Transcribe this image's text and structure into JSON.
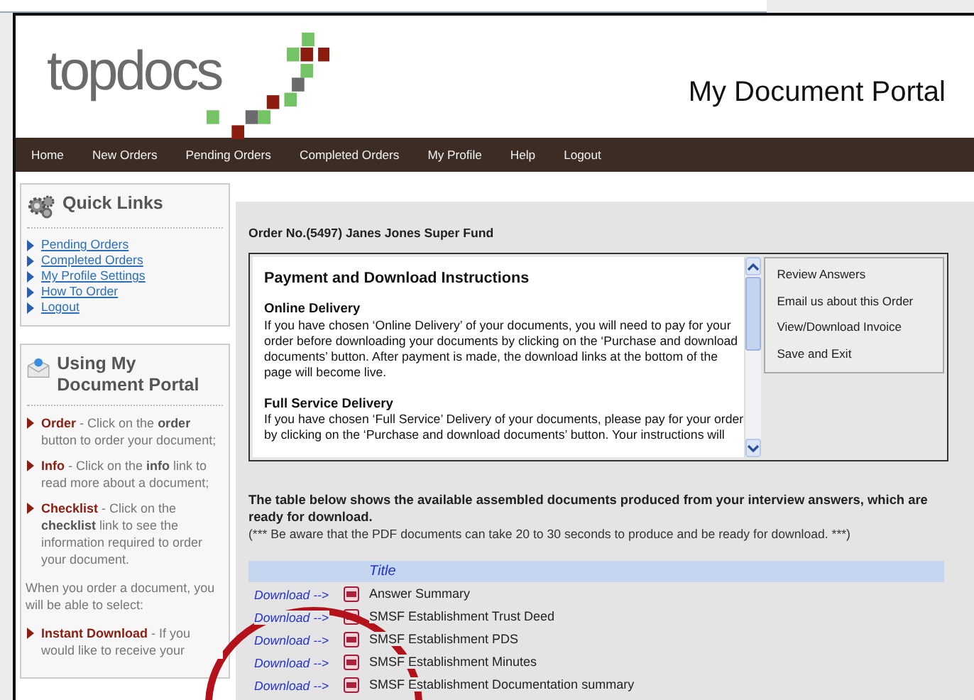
{
  "header": {
    "logo_text": "topdocs",
    "title": "My Document Portal"
  },
  "nav": [
    "Home",
    "New Orders",
    "Pending Orders",
    "Completed Orders",
    "My Profile",
    "Help",
    "Logout"
  ],
  "quick_links": {
    "title": "Quick Links",
    "items": [
      "Pending Orders",
      "Completed Orders",
      "My Profile Settings",
      "How To Order",
      "Logout"
    ]
  },
  "guide": {
    "title": "Using My Document Portal",
    "items": [
      {
        "term": "Order",
        "text": "- Click on the **order** button to order your document;"
      },
      {
        "term": "Info",
        "text": "- Click on the **info** link to read more about a document;"
      },
      {
        "term": "Checklist",
        "text": "- Click on the **checklist** link to see the information required to order your document."
      }
    ],
    "note": "When you order a document, you will be able to select:",
    "options": [
      {
        "term": "Instant Download",
        "text": "- If you would like to receive your"
      }
    ]
  },
  "order_title": "Order No.(5497) Janes Jones Super Fund",
  "instructions": {
    "heading": "Payment and Download Instructions",
    "sections": [
      {
        "title": "Online Delivery",
        "text": "If you have chosen ‘Online Delivery’ of your documents, you will need to pay for your order before downloading your documents by clicking on the ‘Purchase and download documents’ button.  After payment is made, the download links at the bottom of the page will become live."
      },
      {
        "title": "Full Service Delivery",
        "text": "If you have chosen ‘Full Service’ Delivery of your documents, please pay for your order by clicking on the ‘Purchase and download documents’ button.  Your instructions will"
      }
    ]
  },
  "actions": [
    "Review Answers",
    "Email us about this Order",
    "View/Download Invoice",
    "Save and Exit"
  ],
  "table_intro": "The table below shows the available assembled documents produced from your interview answers, which are ready for download.",
  "table_note": "(*** Be aware that the PDF documents can take 20 to 30 seconds to produce and be ready for download. ***)",
  "table": {
    "columns": [
      "Title"
    ],
    "rows": [
      {
        "link": "Download -->",
        "title": "Answer Summary"
      },
      {
        "link": "Download -->",
        "title": "SMSF Establishment Trust Deed"
      },
      {
        "link": "Download -->",
        "title": "SMSF Establishment PDS"
      },
      {
        "link": "Download -->",
        "title": "SMSF Establishment Minutes"
      },
      {
        "link": "Download -->",
        "title": "SMSF Establishment Documentation summary"
      }
    ]
  }
}
